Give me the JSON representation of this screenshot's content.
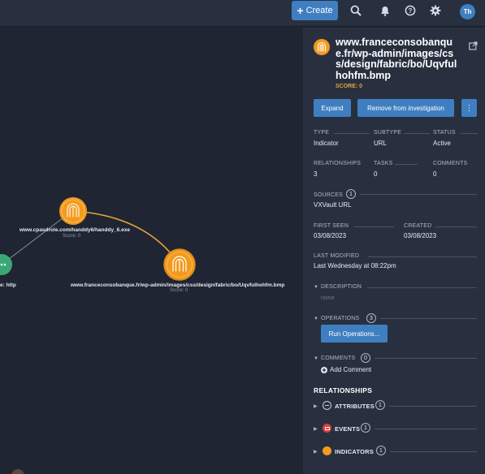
{
  "topbar": {
    "create_label": "Create",
    "icons": [
      "search-icon",
      "bell-icon",
      "help-icon",
      "gear-icon"
    ],
    "avatar_initials": "Th"
  },
  "graph": {
    "nodes": [
      {
        "label": "www.cpasdrole.com/handdy6/handdy_6.exe",
        "score": "Score: 0"
      },
      {
        "label": "www.franceconsobanque.fr/wp-admin/images/css/design/fabric/bo/Uqvfulhohfm.bmp",
        "score": "Score: 0"
      },
      {
        "label": "e: http",
        "score": ""
      }
    ]
  },
  "panel": {
    "title": "www.franceconsobanque.fr/wp-admin/images/css/design/fabric/bo/Uqvfulhohfm.bmp",
    "score": "SCORE: 0",
    "expand_label": "Expand",
    "remove_label": "Remove from investigation",
    "more_label": "⋮",
    "type_label": "TYPE",
    "type_value": "Indicator",
    "subtype_label": "SUBTYPE",
    "subtype_value": "URL",
    "status_label": "STATUS",
    "status_value": "Active",
    "relationships_label": "RELATIONSHIPS",
    "relationships_value": "3",
    "tasks_label": "TASKS",
    "tasks_value": "0",
    "comments_label": "COMMENTS",
    "comments_value": "0",
    "sources_label": "SOURCES",
    "sources_count": "1",
    "sources_value": "VXVault URL",
    "first_seen_label": "FIRST SEEN",
    "first_seen_value": "03/08/2023",
    "created_label": "CREATED",
    "created_value": "03/08/2023",
    "last_modified_label": "LAST MODIFIED",
    "last_modified_value": "Last Wednesday at 08:22pm",
    "description_label": "DESCRIPTION",
    "description_value": "none",
    "operations_label": "OPERATIONS",
    "operations_count": "3",
    "run_operations_label": "Run Operations...",
    "comments_section_label": "COMMENTS",
    "comments_section_count": "0",
    "add_comment_label": "Add Comment",
    "relationships_heading": "RELATIONSHIPS",
    "rel_attributes_label": "ATTRIBUTES",
    "rel_attributes_count": "1",
    "rel_events_label": "EVENTS",
    "rel_events_count": "1",
    "rel_indicators_label": "INDICATORS",
    "rel_indicators_count": "1"
  },
  "colors": {
    "accent_blue": "#3f7fc1",
    "indicator_orange": "#f39a1e",
    "edge_orange": "#e8a23a",
    "event_red": "#d9413b",
    "attribute_green": "#3aa876"
  }
}
